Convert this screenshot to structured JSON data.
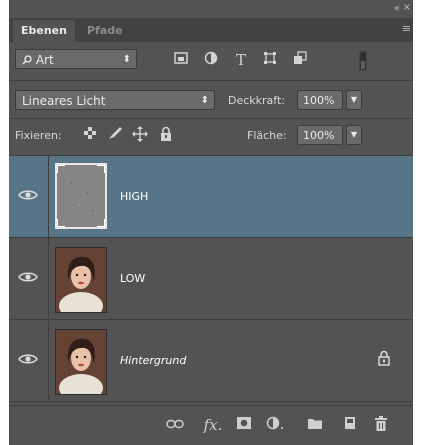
{
  "panel_header": {
    "collapse_icon": "double-chevron-icon",
    "close_icon": "close-icon"
  },
  "tabs": [
    {
      "label": "Ebenen",
      "active": true
    },
    {
      "label": "Pfade",
      "active": false
    }
  ],
  "filter": {
    "kind_label": "Art",
    "icons": [
      "image-filter-icon",
      "adjustment-filter-icon",
      "type-filter-icon",
      "shape-filter-icon",
      "smart-object-filter-icon",
      "filter-toggle-icon"
    ]
  },
  "blend": {
    "mode": "Lineares Licht",
    "opacity_label": "Deckkraft:",
    "opacity_value": "100%"
  },
  "lock": {
    "label": "Fixieren:",
    "fill_label": "Fläche:",
    "fill_value": "100%"
  },
  "layers": [
    {
      "name": "HIGH",
      "selected": true,
      "italic": false,
      "locked": false
    },
    {
      "name": "LOW",
      "selected": false,
      "italic": false,
      "locked": false
    },
    {
      "name": "Hintergrund",
      "selected": false,
      "italic": true,
      "locked": true
    }
  ],
  "bottom_bar": {
    "fx_label": "fx",
    "icons": [
      "link-icon",
      "fx-icon",
      "mask-icon",
      "adjustment-icon",
      "group-folder-icon",
      "new-layer-icon",
      "trash-icon"
    ]
  },
  "colors": {
    "panel_bg": "#535353",
    "selected_layer": "#587487",
    "tab_bar": "#424242"
  }
}
